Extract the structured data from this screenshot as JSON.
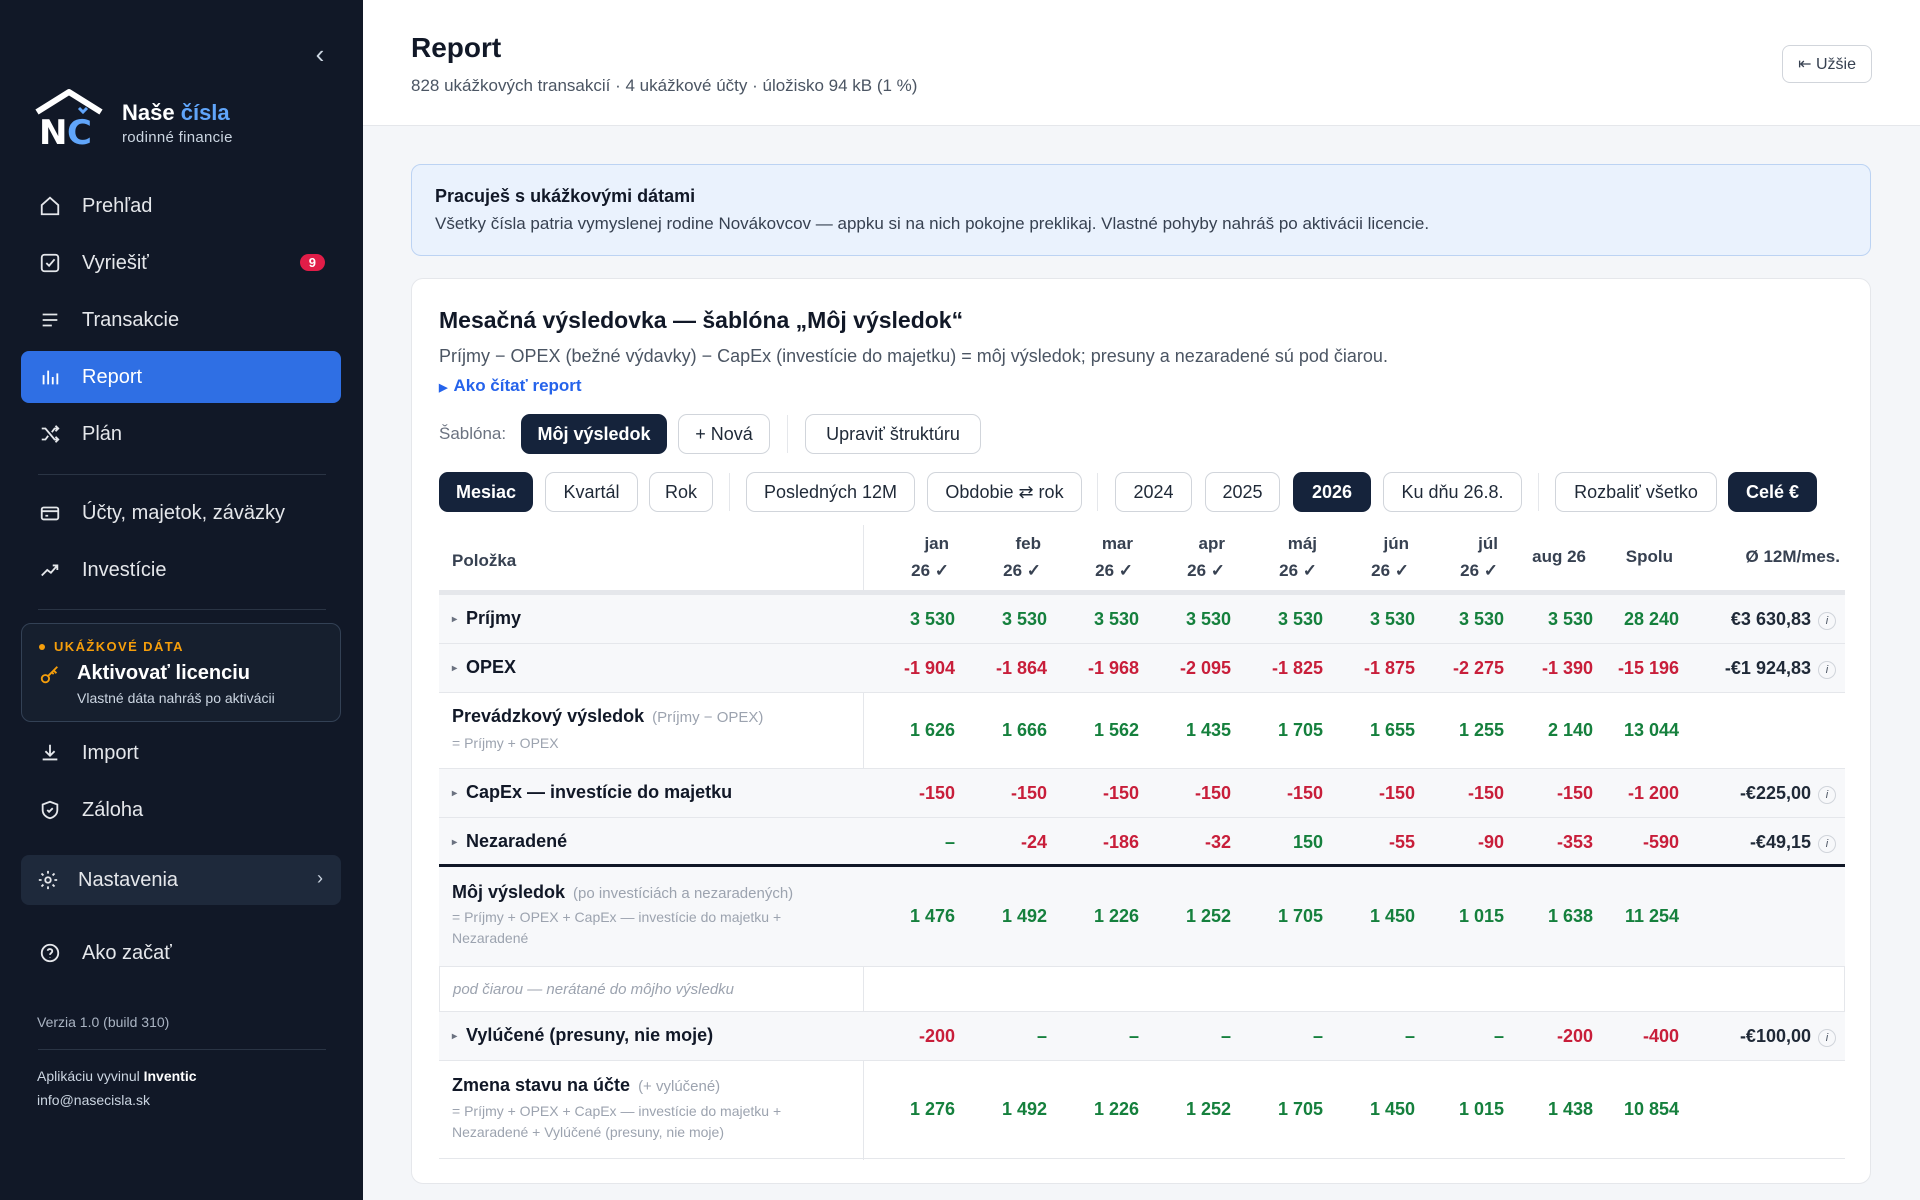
{
  "sidebar": {
    "brand_name_a": "Naše",
    "brand_name_b": "čísla",
    "brand_sub": "rodinné financie",
    "nav": [
      {
        "label": "Prehľad",
        "icon": "home-icon"
      },
      {
        "label": "Vyriešiť",
        "icon": "checkbox-icon",
        "badge": "9"
      },
      {
        "label": "Transakcie",
        "icon": "list-icon"
      },
      {
        "label": "Report",
        "icon": "bar-chart-icon",
        "active": true
      },
      {
        "label": "Plán",
        "icon": "shuffle-icon"
      },
      {
        "label": "Účty, majetok, záväzky",
        "icon": "wallet-icon"
      },
      {
        "label": "Investície",
        "icon": "trend-icon"
      },
      {
        "label": "Import",
        "icon": "download-icon"
      },
      {
        "label": "Záloha",
        "icon": "shield-icon"
      },
      {
        "label": "Ako začať",
        "icon": "help-icon"
      }
    ],
    "demo": {
      "tag": "UKÁŽKOVÉ DÁTA",
      "title": "Aktivovať licenciu",
      "sub": "Vlastné dáta nahráš po aktivácii"
    },
    "settings_label": "Nastavenia",
    "version": "Verzia 1.0 (build 310)",
    "credit_prefix": "Aplikáciu vyvinul",
    "credit_company": "Inventic",
    "credit_email": "info@nasecisla.sk"
  },
  "header": {
    "title": "Report",
    "meta": "828 ukážkových transakcií · 4 ukážkové účty · úložisko 94 kB (1 %)",
    "narrow_button": "⇤ Užšie"
  },
  "notice": {
    "title": "Pracuješ s ukážkovými dátami",
    "text": "Všetky čísla patria vymyslenej rodine Novákovcov — appku si na nich pokojne preklikaj. Vlastné pohyby nahráš po aktivácii licencie."
  },
  "report": {
    "title": "Mesačná výsledovka — šablóna „Môj výsledok“",
    "subtitle": "Príjmy − OPEX (bežné výdavky) − CapEx (investície do majetku) = môj výsledok; presuny a nezaradené sú pod čiarou.",
    "howto": "Ako čítať report",
    "template_label": "Šablóna:",
    "template_buttons": [
      "Môj výsledok",
      "+ Nová",
      "Upraviť štruktúru"
    ],
    "period_buttons": [
      "Mesiac",
      "Kvartál",
      "Rok",
      "Posledných 12M",
      "Obdobie ⇄ rok",
      "2024",
      "2025",
      "2026",
      "Ku dňu 26.8.",
      "Rozbaliť všetko",
      "Celé €"
    ],
    "columns": {
      "label": "Položka",
      "months": [
        {
          "l1": "jan",
          "l2": "26 ✓"
        },
        {
          "l1": "feb",
          "l2": "26 ✓"
        },
        {
          "l1": "mar",
          "l2": "26 ✓"
        },
        {
          "l1": "apr",
          "l2": "26 ✓"
        },
        {
          "l1": "máj",
          "l2": "26 ✓"
        },
        {
          "l1": "jún",
          "l2": "26 ✓"
        },
        {
          "l1": "júl",
          "l2": "26 ✓"
        },
        {
          "l1": "aug 26",
          "l2": ""
        }
      ],
      "total": "Spolu",
      "avg": "Ø 12M/mes."
    },
    "rows": [
      {
        "label": "Príjmy",
        "values": [
          "3 530",
          "3 530",
          "3 530",
          "3 530",
          "3 530",
          "3 530",
          "3 530",
          "3 530",
          "28 240"
        ],
        "avg": "€3 630,83"
      },
      {
        "label": "OPEX",
        "values": [
          "-1 904",
          "-1 864",
          "-1 968",
          "-2 095",
          "-1 825",
          "-1 875",
          "-2 275",
          "-1 390",
          "-15 196"
        ],
        "avg": "-€1 924,83"
      },
      {
        "label": "Prevádzkový výsledok",
        "note": "(Príjmy − OPEX)",
        "formula": "= Príjmy + OPEX",
        "values": [
          "1 626",
          "1 666",
          "1 562",
          "1 435",
          "1 705",
          "1 655",
          "1 255",
          "2 140",
          "13 044"
        ],
        "avg": ""
      },
      {
        "label": "CapEx — investície do majetku",
        "values": [
          "-150",
          "-150",
          "-150",
          "-150",
          "-150",
          "-150",
          "-150",
          "-150",
          "-1 200"
        ],
        "avg": "-€225,00"
      },
      {
        "label": "Nezaradené",
        "values": [
          "–",
          "-24",
          "-186",
          "-32",
          "150",
          "-55",
          "-90",
          "-353",
          "-590"
        ],
        "avg": "-€49,15"
      },
      {
        "label": "Môj výsledok",
        "note": "(po investíciách a nezaradených)",
        "formula": "= Príjmy + OPEX + CapEx — investície do majetku + Nezaradené",
        "values": [
          "1 476",
          "1 492",
          "1 226",
          "1 252",
          "1 705",
          "1 450",
          "1 015",
          "1 638",
          "11 254"
        ],
        "avg": ""
      },
      {
        "label": "Vylúčené (presuny, nie moje)",
        "values": [
          "-200",
          "–",
          "–",
          "–",
          "–",
          "–",
          "–",
          "-200",
          "-400"
        ],
        "avg": "-€100,00"
      },
      {
        "label": "Zmena stavu na účte",
        "note": "(+ vylúčené)",
        "formula": "= Príjmy + OPEX + CapEx — investície do majetku + Nezaradené + Vylúčené (presuny, nie moje)",
        "values": [
          "1 276",
          "1 492",
          "1 226",
          "1 252",
          "1 705",
          "1 450",
          "1 015",
          "1 438",
          "10 854"
        ],
        "avg": ""
      }
    ],
    "below_line": "pod čiarou — nerátané do môjho výsledku"
  },
  "colors": {
    "accent": "#2f6fe4",
    "sidebar_bg": "#111827",
    "positive": "#15803d",
    "negative": "#c81e3a",
    "dark_pill": "#15233b"
  }
}
